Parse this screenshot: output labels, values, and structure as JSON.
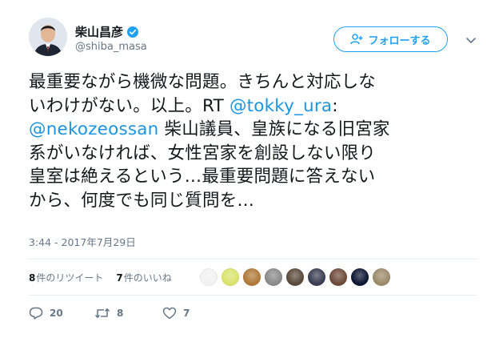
{
  "user": {
    "name": "柴山昌彦",
    "handle": "@shiba_masa",
    "verified": true
  },
  "follow_button": {
    "label": "フォローする",
    "icon": "add-user-icon"
  },
  "more_menu": {
    "icon": "chevron-down-icon"
  },
  "tweet": {
    "lines": [
      [
        {
          "text": "最重要ながら機微な問題。きちんと対応しな"
        }
      ],
      [
        {
          "text": "いわけがない。以上。RT "
        },
        {
          "text": "@tokky_ura",
          "link": true
        },
        {
          "text": ":"
        }
      ],
      [
        {
          "text": "@nekozeossan",
          "link": true
        },
        {
          "text": " 柴山議員、皇族になる旧宮家"
        }
      ],
      [
        {
          "text": "系がいなければ、女性宮家を創設しない限り"
        }
      ],
      [
        {
          "text": "皇室は絶えるという…最重要問題に答えない"
        }
      ],
      [
        {
          "text": "から、何度でも同じ質問を…"
        }
      ]
    ],
    "timestamp": "3:44 - 2017年7月29日"
  },
  "stats": {
    "retweets_count": "8",
    "retweets_label": "件のリツイート",
    "likes_count": "7",
    "likes_label": "件のいいね",
    "likers": [
      {
        "icon": "sketch-avatar",
        "color": "#f2f2f2"
      },
      {
        "icon": "sponge-avatar",
        "color": "#d9e36b"
      },
      {
        "icon": "lion-avatar",
        "color": "#b07a3a"
      },
      {
        "icon": "dog-avatar",
        "color": "#8a8a8a"
      },
      {
        "icon": "portrait-avatar",
        "color": "#5b4a3c"
      },
      {
        "icon": "suit-avatar",
        "color": "#3a3f52"
      },
      {
        "icon": "woman-avatar",
        "color": "#6e4b3a"
      },
      {
        "icon": "eye-avatar",
        "color": "#0c1733"
      },
      {
        "icon": "landscape-avatar",
        "color": "#9c8a6a"
      }
    ]
  },
  "actions": {
    "reply_count": "20",
    "retweet_count": "8",
    "like_count": "7"
  },
  "colors": {
    "link": "#1b95e0",
    "accent": "#1da1f2",
    "muted": "#657786",
    "text": "#14171a"
  }
}
